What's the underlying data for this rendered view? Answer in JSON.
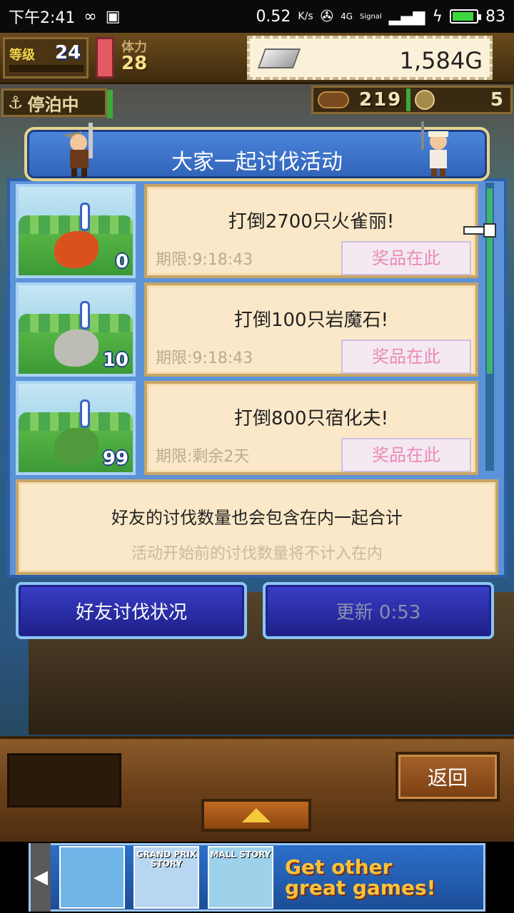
{
  "status_bar": {
    "time": "下午2:41",
    "net_speed": "0.52",
    "net_unit": "K/s",
    "network": "4G",
    "signal_label": "Signal",
    "battery": "83"
  },
  "hud": {
    "level_label": "等级",
    "level": "24",
    "stamina_label": "体力",
    "stamina": "28",
    "gold": "1,584G",
    "status": "停泊中",
    "resource_1": "219",
    "resource_2": "5"
  },
  "dialog": {
    "title": "大家一起讨伐活动",
    "quests": [
      {
        "task": "打倒2700只火雀丽!",
        "deadline": "期限:9:18:43",
        "reward": "奖品在此",
        "count": "0",
        "monster_color": "#d9521e"
      },
      {
        "task": "打倒100只岩魔石!",
        "deadline": "期限:9:18:43",
        "reward": "奖品在此",
        "count": "10",
        "monster_color": "#bdbdb6"
      },
      {
        "task": "打倒800只宿化夫!",
        "deadline": "期限:剩余2天",
        "reward": "奖品在此",
        "count": "99",
        "monster_color": "#4f9a3c"
      }
    ],
    "note_line1": "好友的讨伐数量也会包含在内一起合计",
    "note_line2": "活动开始前的讨伐数量将不计入在内",
    "friends_button": "好友讨伐状况",
    "refresh_button": "更新 0:53"
  },
  "bottom": {
    "back_button": "返回"
  },
  "ad": {
    "games": [
      {
        "name": "",
        "color": "#6fb5e8"
      },
      {
        "name": "GRAND PRIX STORY",
        "color": "#b8d6f2"
      },
      {
        "name": "MALL STORY",
        "color": "#9ed1ea"
      }
    ],
    "cta_line1": "Get other",
    "cta_line2": "great games!"
  },
  "colors": {
    "dialog_blue": "#5c93d8",
    "reward_pink": "#e88ab6",
    "button_blue": "#2b2fa8"
  }
}
